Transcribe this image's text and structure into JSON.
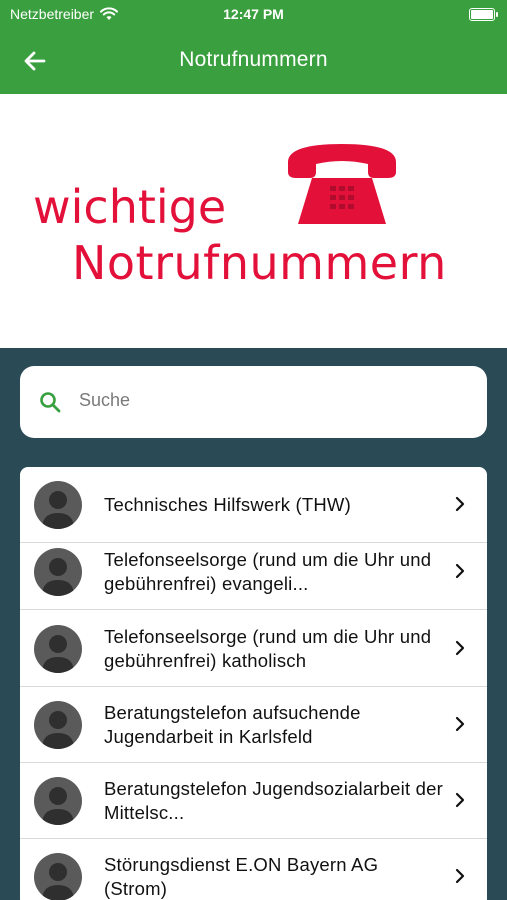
{
  "status_bar": {
    "carrier": "Netzbetreiber",
    "time": "12:47 PM"
  },
  "app_bar": {
    "title": "Notrufnummern"
  },
  "banner": {
    "line1": "wichtige",
    "line2": "Notrufnummern",
    "color": "#e3103a"
  },
  "search": {
    "placeholder": "Suche"
  },
  "contacts": [
    {
      "name": "Technisches Hilfswerk (THW)"
    },
    {
      "name": "Telefonseelsorge (rund um die Uhr und gebührenfrei) evangeli..."
    },
    {
      "name": "Telefonseelsorge (rund um die Uhr und gebührenfrei) katholisch"
    },
    {
      "name": "Beratungstelefon aufsuchende Jugendarbeit in Karlsfeld"
    },
    {
      "name": "Beratungstelefon Jugendsozialarbeit der Mittelsc..."
    },
    {
      "name": "Störungsdienst E.ON Bayern AG (Strom)"
    }
  ],
  "colors": {
    "accent": "#3aa03f",
    "background": "#2a4a56"
  }
}
